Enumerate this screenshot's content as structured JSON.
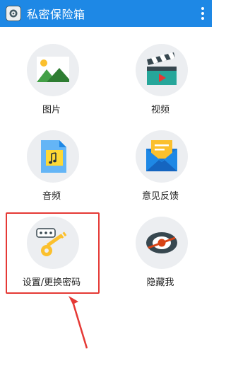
{
  "app": {
    "title": "私密保险箱",
    "icon": "safe-icon"
  },
  "menu": {
    "icon": "more-vert-icon"
  },
  "tiles": [
    {
      "label": "图片",
      "icon": "image-icon"
    },
    {
      "label": "视频",
      "icon": "clapperboard-icon"
    },
    {
      "label": "音频",
      "icon": "music-file-icon"
    },
    {
      "label": "意见反馈",
      "icon": "envelope-icon"
    },
    {
      "label": "设置/更换密码",
      "icon": "key-password-icon"
    },
    {
      "label": "隐藏我",
      "icon": "hide-eye-icon"
    }
  ],
  "annotation": {
    "highlight_color": "#e53935",
    "target": "设置/更换密码"
  },
  "colors": {
    "appbar": "#1e88e5",
    "tile_bg": "#eceef1"
  }
}
